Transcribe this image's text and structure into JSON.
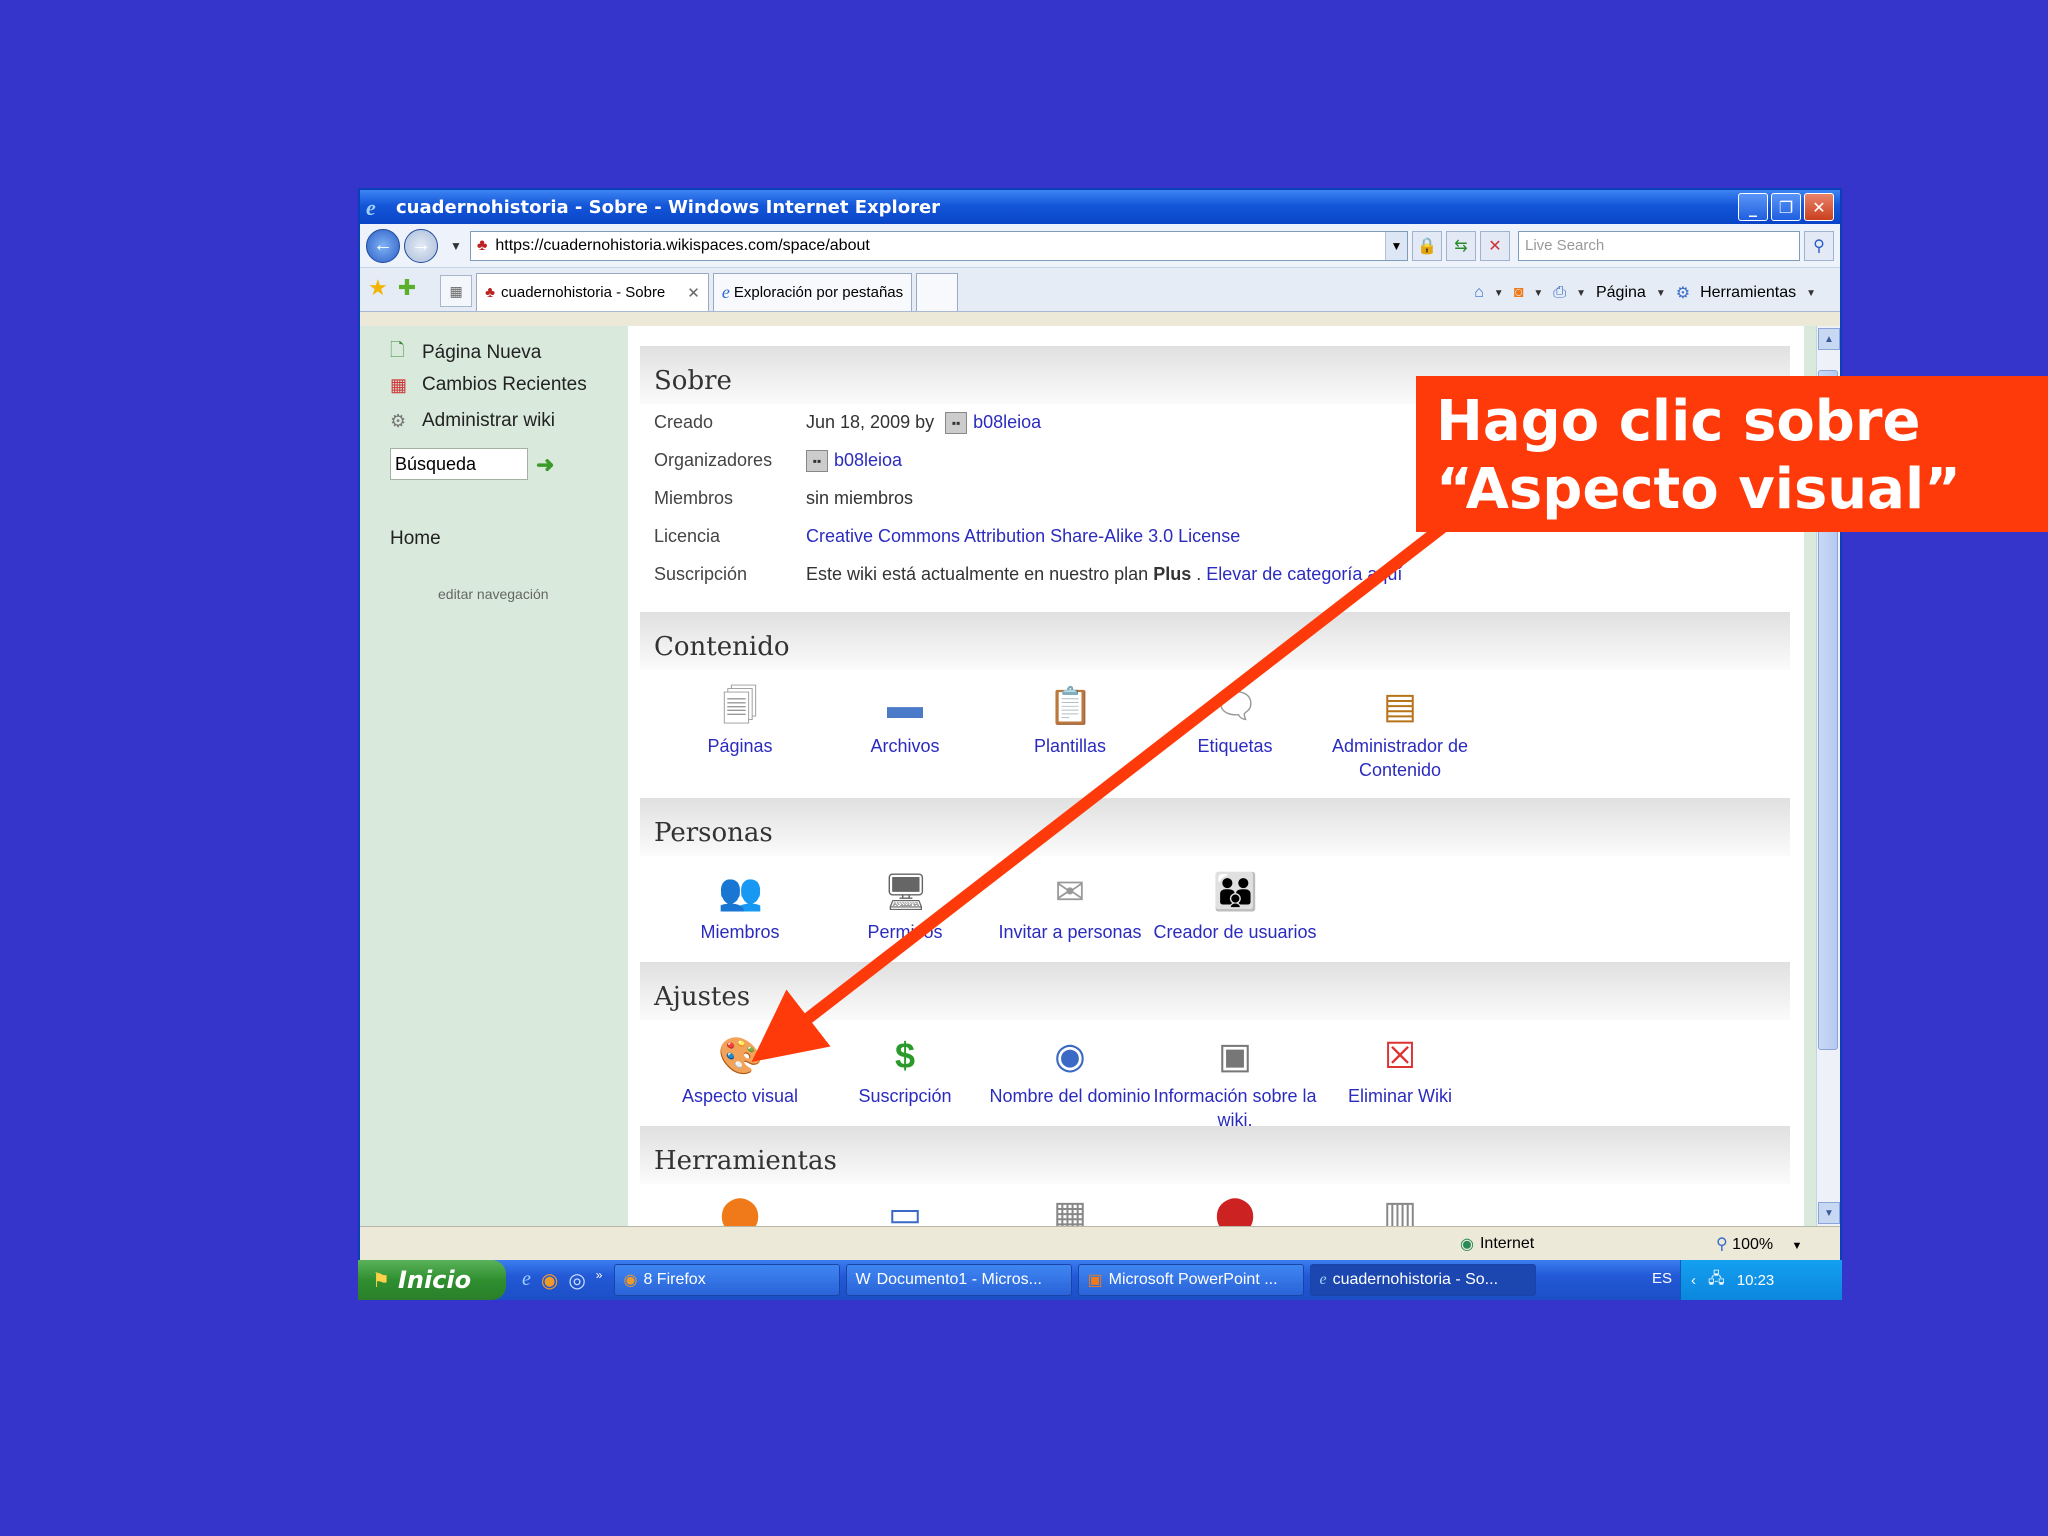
{
  "window": {
    "title": "cuadernohistoria - Sobre - Windows Internet Explorer",
    "url": "https://cuadernohistoria.wikispaces.com/space/about",
    "search_placeholder": "Live Search"
  },
  "tabs": [
    {
      "label": "cuadernohistoria - Sobre",
      "active": true
    },
    {
      "label": "Exploración por pestañas",
      "active": false
    }
  ],
  "cmdbar": {
    "page": "Página",
    "tools": "Herramientas"
  },
  "sidebar": {
    "items": [
      "Página Nueva",
      "Cambios Recientes",
      "Administrar wiki"
    ],
    "search_value": "Búsqueda",
    "home": "Home",
    "edit_nav": "editar navegación"
  },
  "sobre": {
    "title": "Sobre",
    "labels": {
      "creado": "Creado",
      "org": "Organizadores",
      "miembros": "Miembros",
      "licencia": "Licencia",
      "suscripcion": "Suscripción"
    },
    "creado_date": "Jun 18, 2009 by",
    "user": "b08leioa",
    "miembros_val": "sin miembros",
    "licencia_val": "Creative Commons Attribution Share-Alike 3.0 License",
    "suscripcion_pre": "Este wiki está actualmente en nuestro plan",
    "plan": "Plus",
    "suscripcion_link": "Elevar de categoría aquí"
  },
  "contenido": {
    "title": "Contenido",
    "items": [
      "Páginas",
      "Archivos",
      "Plantillas",
      "Etiquetas",
      "Administrador de Contenido"
    ]
  },
  "personas": {
    "title": "Personas",
    "items": [
      "Miembros",
      "Permisos",
      "Invitar a personas",
      "Creador de usuarios"
    ]
  },
  "ajustes": {
    "title": "Ajustes",
    "items": [
      "Aspecto visual",
      "Suscripción",
      "Nombre del dominio",
      "Información sobre la wiki.",
      "Eliminar Wiki"
    ]
  },
  "herramientas": {
    "title": "Herramientas"
  },
  "statusbar": {
    "zone": "Internet",
    "zoom": "100%"
  },
  "taskbar": {
    "start": "Inicio",
    "tasks": [
      "8 Firefox",
      "Documento1 - Micros...",
      "Microsoft PowerPoint ...",
      "cuadernohistoria - So..."
    ],
    "lang": "ES",
    "clock": "10:23"
  },
  "callout": {
    "line1": "Hago clic sobre",
    "line2": "“Aspecto visual”"
  },
  "colors": {
    "desktop": "#3535cc",
    "callout": "#ff3a0a",
    "link": "#2b2bbf",
    "sidebar": "#d9eadd"
  }
}
